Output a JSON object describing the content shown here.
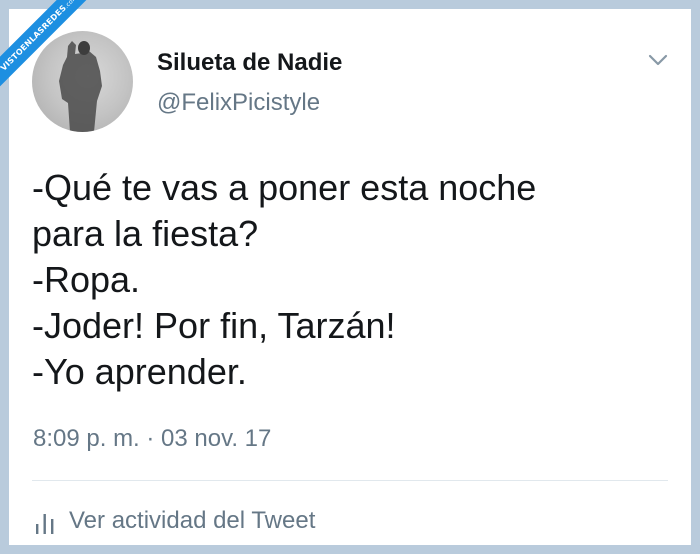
{
  "watermark": {
    "text": "VISTOENLASREDES",
    "suffix": ".com"
  },
  "tweet": {
    "display_name": "Silueta de Nadie",
    "handle": "@FelixPicistyle",
    "lines": [
      "-Qué te vas a poner esta noche",
      "para la fiesta?",
      "-Ropa.",
      "-Joder! Por fin, Tarzán!",
      "-Yo aprender."
    ],
    "timestamp": "8:09 p. m. · 03 nov. 17",
    "activity_label": "Ver actividad del Tweet"
  },
  "icons": {
    "menu": "chevron-down-icon",
    "activity": "bar-chart-icon"
  },
  "colors": {
    "background": "#b9cbdc",
    "card": "#ffffff",
    "text_primary": "#14171a",
    "text_secondary": "#657786",
    "watermark": "#1d8fe1"
  }
}
